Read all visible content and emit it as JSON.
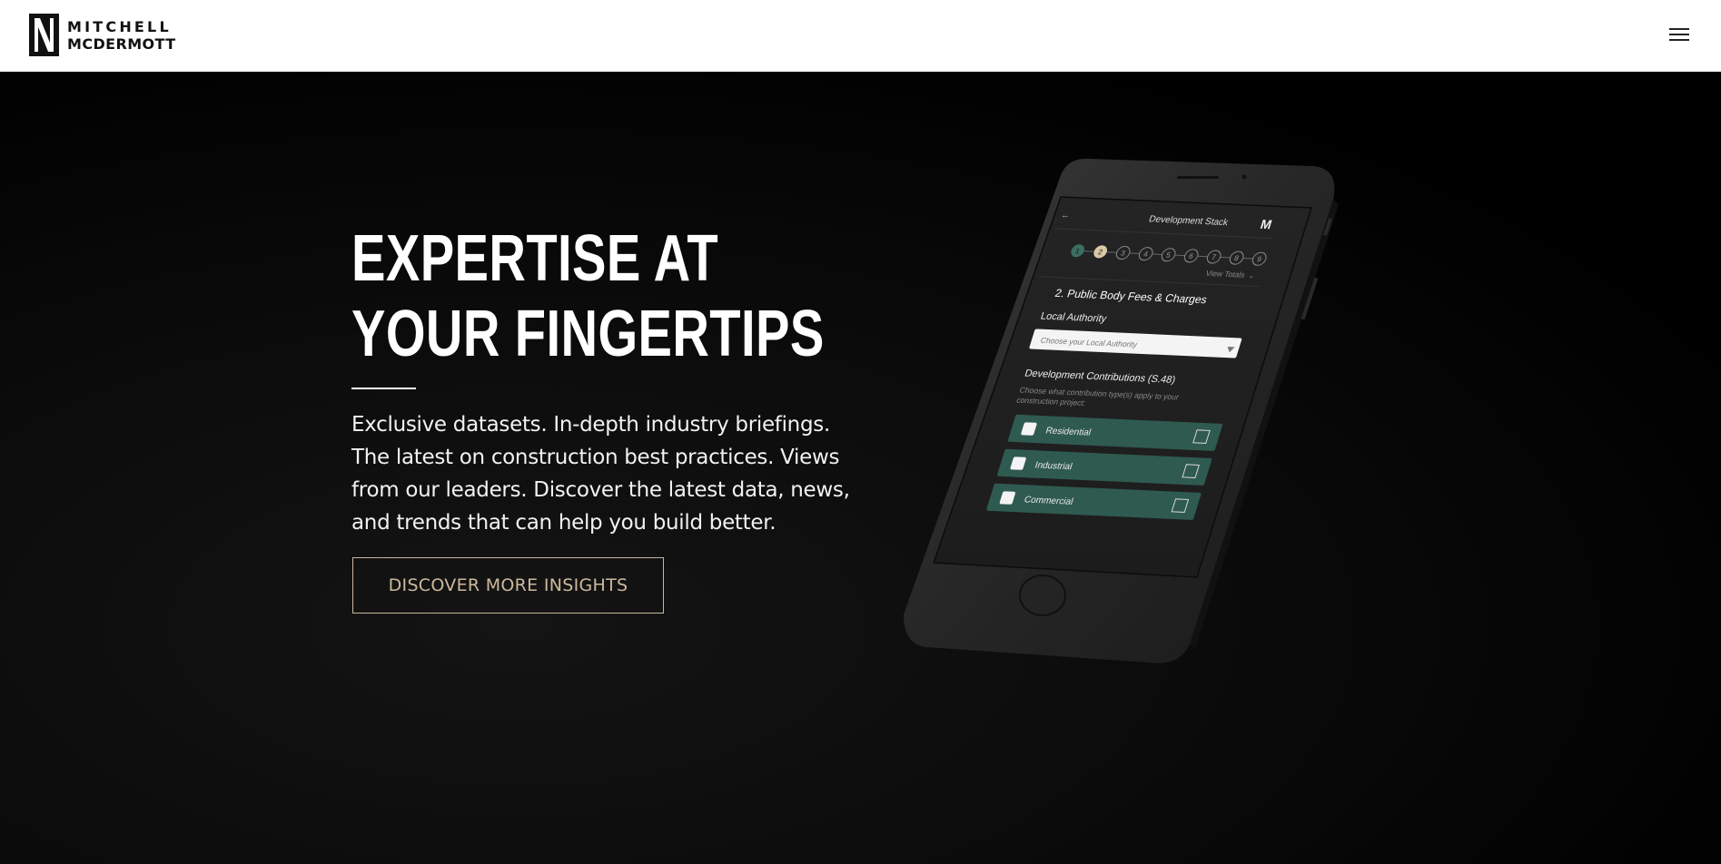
{
  "header": {
    "logo_line1": "MITCHELL",
    "logo_line2": "MCDERMOTT",
    "menu_icon": "hamburger-menu-icon"
  },
  "hero": {
    "headline_line1": "EXPERTISE AT",
    "headline_line2": "YOUR FINGERTIPS",
    "lead": "Exclusive datasets. In-depth industry briefings. The latest on construction best practices. Views from our leaders. Discover the latest data, news, and trends that can help you build better.",
    "cta_label": "DISCOVER MORE INSIGHTS"
  },
  "phone_app": {
    "title": "Development Stack",
    "steps": [
      "1",
      "2",
      "3",
      "4",
      "5",
      "6",
      "7",
      "8",
      "9"
    ],
    "active_step": "2",
    "view_totals": "View Totals",
    "section_title": "2. Public Body Fees & Charges",
    "local_authority_label": "Local Authority",
    "local_authority_placeholder": "Choose your Local Authority",
    "contributions_title": "Development Contributions (S.48)",
    "contributions_hint_line1": "Choose what contribution type(s) apply to your",
    "contributions_hint_line2": "construction project:",
    "options": [
      "Residential",
      "Industrial",
      "Commercial"
    ]
  },
  "colors": {
    "accent_gold": "#cdb99c",
    "option_green": "#2f5a50",
    "step_active_green": "#3d6e62",
    "step_current_gold": "#d9c9a8"
  }
}
